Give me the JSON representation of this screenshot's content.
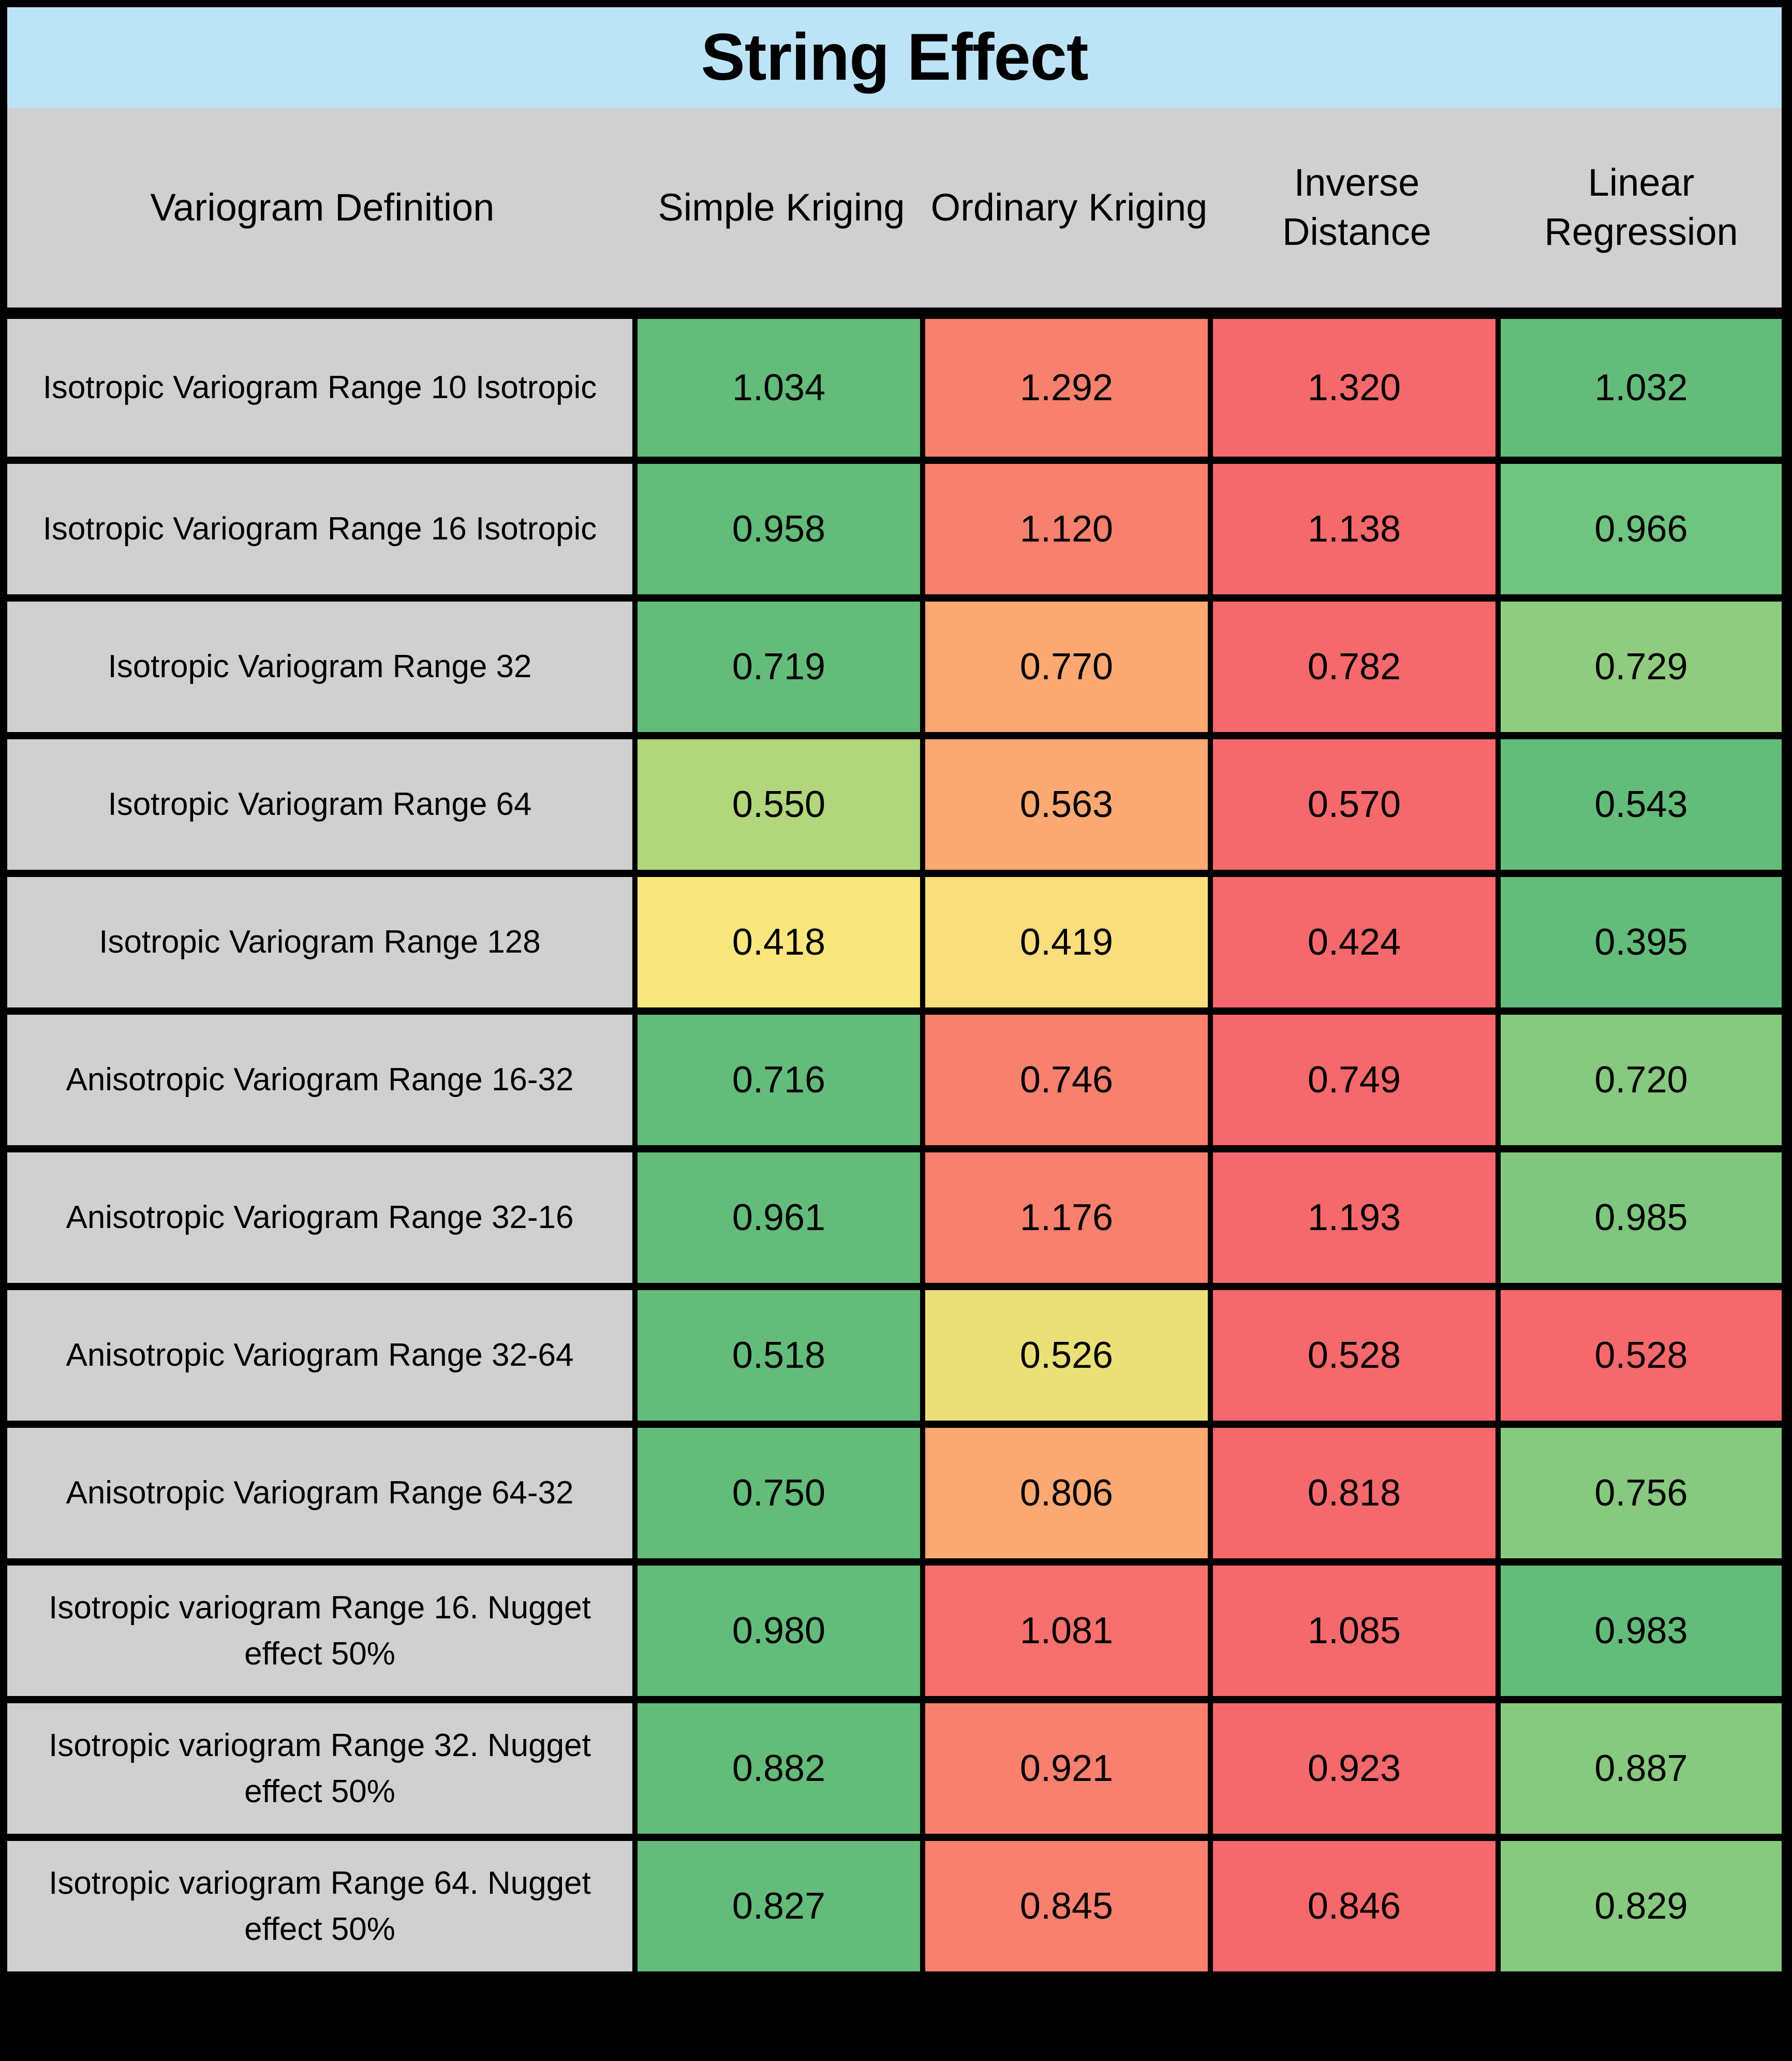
{
  "title": "String Effect",
  "colors": {
    "title_band": "#bde3f6",
    "header_bg": "#d0d0d0",
    "label_bg": "#d0d0d0",
    "border": "#000000",
    "green_dark": "#63bc7a",
    "green_mid": "#87c97e",
    "green_light": "#b1d67c",
    "yellow": "#f9e67d",
    "orange": "#fba872",
    "salmon": "#f8806f",
    "red": "#f5696d"
  },
  "table": {
    "columns": [
      "Variogram Definition",
      "Simple Kriging",
      "Ordinary Kriging",
      "Inverse Distance",
      "Linear Regression"
    ],
    "rows": [
      {
        "label": "Isotropic Variogram Range 10 Isotropic",
        "values": [
          "1.034",
          "1.292",
          "1.320",
          "1.032"
        ],
        "cell_colors": [
          "#63bc7a",
          "#f8806f",
          "#f5696d",
          "#63bc7a"
        ],
        "height": "tall"
      },
      {
        "label": "Isotropic Variogram Range 16 Isotropic",
        "values": [
          "0.958",
          "1.120",
          "1.138",
          "0.966"
        ],
        "cell_colors": [
          "#63bc7a",
          "#f8806f",
          "#f5696d",
          "#6fc47f"
        ],
        "height": "tall"
      },
      {
        "label": "Isotropic Variogram Range 32",
        "values": [
          "0.719",
          "0.770",
          "0.782",
          "0.729"
        ],
        "cell_colors": [
          "#63bc7a",
          "#fba872",
          "#f5696d",
          "#8fcc7f"
        ],
        "height": "tall"
      },
      {
        "label": "Isotropic Variogram Range 64",
        "values": [
          "0.550",
          "0.563",
          "0.570",
          "0.543"
        ],
        "cell_colors": [
          "#b1d67c",
          "#fba872",
          "#f5696d",
          "#63bc7a"
        ],
        "height": "tall"
      },
      {
        "label": "Isotropic Variogram Range 128",
        "values": [
          "0.418",
          "0.419",
          "0.424",
          "0.395"
        ],
        "cell_colors": [
          "#f9e67d",
          "#fadd7c",
          "#f5696d",
          "#63bc7a"
        ],
        "height": "tall"
      },
      {
        "label": "Anisotropic Variogram Range 16-32",
        "values": [
          "0.716",
          "0.746",
          "0.749",
          "0.720"
        ],
        "cell_colors": [
          "#63bc7a",
          "#f8806f",
          "#f5696d",
          "#87c97e"
        ],
        "height": "tall"
      },
      {
        "label": "Anisotropic Variogram Range 32-16",
        "values": [
          "0.961",
          "1.176",
          "1.193",
          "0.985"
        ],
        "cell_colors": [
          "#63bc7a",
          "#f8806f",
          "#f5696d",
          "#7fc77e"
        ],
        "height": "tall"
      },
      {
        "label": "Anisotropic Variogram Range 32-64",
        "values": [
          "0.518",
          "0.526",
          "0.528",
          "0.528"
        ],
        "cell_colors": [
          "#63bc7a",
          "#eae077",
          "#f5696d",
          "#f5696d"
        ],
        "height": "tall"
      },
      {
        "label": "Anisotropic Variogram Range 64-32",
        "values": [
          "0.750",
          "0.806",
          "0.818",
          "0.756"
        ],
        "cell_colors": [
          "#63bc7a",
          "#fba872",
          "#f5696d",
          "#87c97e"
        ],
        "height": "tall"
      },
      {
        "label": "Isotropic variogram Range 16. Nugget effect 50%",
        "values": [
          "0.980",
          "1.081",
          "1.085",
          "0.983"
        ],
        "cell_colors": [
          "#63bc7a",
          "#f8706d",
          "#f5696d",
          "#63bc7a"
        ],
        "height": "tall"
      },
      {
        "label": "Isotropic variogram Range 32. Nugget effect 50%",
        "values": [
          "0.882",
          "0.921",
          "0.923",
          "0.887"
        ],
        "cell_colors": [
          "#63bc7a",
          "#f8806f",
          "#f5696d",
          "#87c97e"
        ],
        "height": "tall"
      },
      {
        "label": "Isotropic variogram Range 64. Nugget effect 50%",
        "values": [
          "0.827",
          "0.845",
          "0.846",
          "0.829"
        ],
        "cell_colors": [
          "#63bc7a",
          "#f8806f",
          "#f5696d",
          "#87c97e"
        ],
        "height": "tall"
      }
    ]
  },
  "chart_data": {
    "type": "table",
    "title": "String Effect",
    "categories": [
      "Isotropic Variogram Range 10 Isotropic",
      "Isotropic Variogram Range 16 Isotropic",
      "Isotropic Variogram Range 32",
      "Isotropic Variogram Range 64",
      "Isotropic Variogram Range 128",
      "Anisotropic Variogram Range 16-32",
      "Anisotropic Variogram Range 32-16",
      "Anisotropic Variogram Range 32-64",
      "Anisotropic Variogram Range 64-32",
      "Isotropic variogram Range 16. Nugget effect 50%",
      "Isotropic variogram Range 32. Nugget effect 50%",
      "Isotropic variogram Range 64. Nugget effect 50%"
    ],
    "series": [
      {
        "name": "Simple Kriging",
        "values": [
          1.034,
          0.958,
          0.719,
          0.55,
          0.418,
          0.716,
          0.961,
          0.518,
          0.75,
          0.98,
          0.882,
          0.827
        ]
      },
      {
        "name": "Ordinary Kriging",
        "values": [
          1.292,
          1.12,
          0.77,
          0.563,
          0.419,
          0.746,
          1.176,
          0.526,
          0.806,
          1.081,
          0.921,
          0.845
        ]
      },
      {
        "name": "Inverse Distance",
        "values": [
          1.32,
          1.138,
          0.782,
          0.57,
          0.424,
          0.749,
          1.193,
          0.528,
          0.818,
          1.085,
          0.923,
          0.846
        ]
      },
      {
        "name": "Linear Regression",
        "values": [
          1.032,
          0.966,
          0.729,
          0.543,
          0.395,
          0.72,
          0.985,
          0.528,
          0.756,
          0.983,
          0.887,
          0.829
        ]
      }
    ],
    "xlabel": "Variogram Definition",
    "ylabel": "",
    "legend_position": "top"
  }
}
